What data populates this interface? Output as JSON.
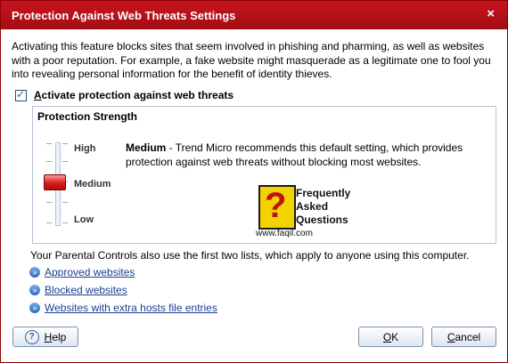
{
  "window": {
    "title": "Protection Against Web Threats Settings",
    "close_glyph": "×"
  },
  "intro": "Activating this feature blocks sites that seem involved in phishing and pharming, as well as websites with a poor reputation. For example, a fake website might masquerade as a legitimate one to fool you into revealing personal information for the benefit of identity thieves.",
  "activate": {
    "accel": "A",
    "label_rest": "ctivate protection against web threats",
    "checked": true,
    "check_glyph": "✓"
  },
  "strength": {
    "title": "Protection Strength",
    "levels": [
      "High",
      "Medium",
      "Low"
    ],
    "selected": "Medium",
    "selected_level_name": "Medium",
    "description_rest": " - Trend Micro recommends this default setting, which provides protection against web threats without blocking most websites."
  },
  "watermark": {
    "glyph": "?",
    "text": [
      "Frequently",
      "Asked",
      "Questions"
    ],
    "url": "www.faqil.com"
  },
  "parental_note": "Your Parental Controls also use the first two lists, which apply to anyone using this computer.",
  "links": [
    "Approved websites",
    "Blocked websites",
    "Websites with extra hosts file entries"
  ],
  "link_glyph": "»",
  "buttons": {
    "help_icon": "?",
    "help_accel": "H",
    "help_rest": "elp",
    "ok_accel": "O",
    "ok_rest": "K",
    "cancel_accel": "C",
    "cancel_rest": "ancel"
  },
  "colors": {
    "titlebar": "#b5111b",
    "link": "#1a3f8f",
    "slider_thumb": "#d51a1a"
  }
}
